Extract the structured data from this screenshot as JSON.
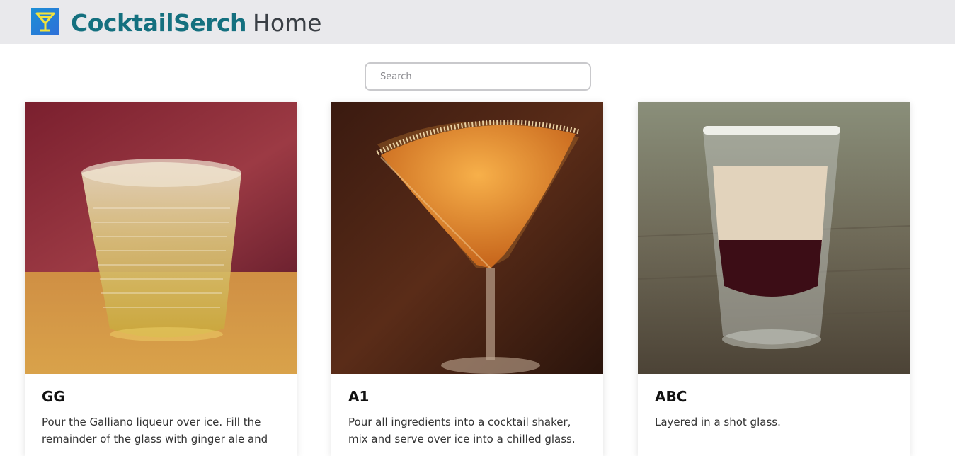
{
  "header": {
    "brand": "CocktailSerch",
    "home_link": "Home",
    "logo_icon": "cocktail-glass-icon",
    "brand_color": "#14707f"
  },
  "search": {
    "placeholder": "Search",
    "value": ""
  },
  "cards": [
    {
      "title": "GG",
      "text": "Pour the Galliano liqueur over ice. Fill the remainder of the glass with ginger ale and",
      "image": "rocks-glass-drink-photo"
    },
    {
      "title": "A1",
      "text": "Pour all ingredients into a cocktail shaker, mix and serve over ice into a chilled glass.",
      "image": "martini-glass-drink-photo"
    },
    {
      "title": "ABC",
      "text": "Layered in a shot glass.",
      "image": "layered-shot-glass-photo"
    }
  ]
}
